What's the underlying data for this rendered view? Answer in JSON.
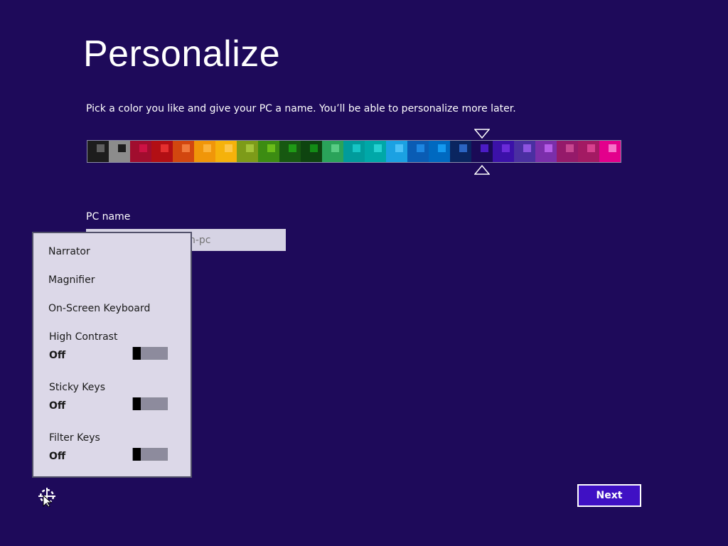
{
  "page": {
    "title": "Personalize"
  },
  "instructions": "Pick a color you like and give your PC a name. You’ll be able to personalize more later.",
  "palette": {
    "selected_index": 18,
    "swatches": [
      {
        "bg": "#1d1d1d",
        "accent": "#606060"
      },
      {
        "bg": "#8c8c8c",
        "accent": "#1d1d1d"
      },
      {
        "bg": "#a10d2e",
        "accent": "#cc1244"
      },
      {
        "bg": "#b20f14",
        "accent": "#e42f2f"
      },
      {
        "bg": "#d2470f",
        "accent": "#f07a3c"
      },
      {
        "bg": "#f09609",
        "accent": "#fbb33a"
      },
      {
        "bg": "#f5b20b",
        "accent": "#fcc649"
      },
      {
        "bg": "#7d9b19",
        "accent": "#a4c33a"
      },
      {
        "bg": "#3c8c12",
        "accent": "#6bbd1a"
      },
      {
        "bg": "#175811",
        "accent": "#1f9a16"
      },
      {
        "bg": "#0e4410",
        "accent": "#138b16"
      },
      {
        "bg": "#2aa35a",
        "accent": "#59cc85"
      },
      {
        "bg": "#019b9b",
        "accent": "#17c5c5"
      },
      {
        "bg": "#00a8a8",
        "accent": "#26d1d1"
      },
      {
        "bg": "#1ba1e2",
        "accent": "#4cc1f7"
      },
      {
        "bg": "#0a5cb4",
        "accent": "#1d86e2"
      },
      {
        "bg": "#0069c0",
        "accent": "#159af0"
      },
      {
        "bg": "#0a2560",
        "accent": "#2b64c2"
      },
      {
        "bg": "#1a0a56",
        "accent": "#4b1cc4"
      },
      {
        "bg": "#3b11a8",
        "accent": "#6a2bd8"
      },
      {
        "bg": "#4a2fa1",
        "accent": "#8d54e0"
      },
      {
        "bg": "#7a2eaa",
        "accent": "#b45ce6"
      },
      {
        "bg": "#951a6a",
        "accent": "#c84790"
      },
      {
        "bg": "#a31a63",
        "accent": "#d8418f"
      },
      {
        "bg": "#e3008c",
        "accent": "#f773c9"
      }
    ]
  },
  "pc_name": {
    "label": "PC name",
    "placeholder": "Example: livingroom-pc",
    "value": ""
  },
  "ease_of_access": {
    "menu": [
      "Narrator",
      "Magnifier",
      "On-Screen Keyboard"
    ],
    "toggles": [
      {
        "label": "High Contrast",
        "state": "Off"
      },
      {
        "label": "Sticky Keys",
        "state": "Off"
      },
      {
        "label": "Filter Keys",
        "state": "Off"
      }
    ]
  },
  "next_label": "Next"
}
